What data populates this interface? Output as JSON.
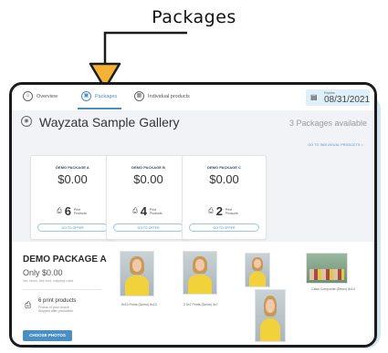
{
  "callout": {
    "label": "Packages"
  },
  "tabs": [
    {
      "label": "Overview",
      "icon": "home-icon"
    },
    {
      "label": "Packages",
      "icon": "gift-icon",
      "active": true
    },
    {
      "label": "Individual products",
      "icon": "photo-icon"
    }
  ],
  "expires": {
    "label": "Expires",
    "date": "08/31/2021"
  },
  "gallery": {
    "title": "Wayzata Sample Gallery",
    "package_count": "3 Packages available"
  },
  "link_individual": "GO TO INDIVIDUAL PRODUCTS >",
  "packages": [
    {
      "name": "DEMO PACKAGE A",
      "price": "$0.00",
      "count": "6",
      "count_label": "Print Products",
      "button": "GO TO OFFER"
    },
    {
      "name": "DEMO PACKAGE B",
      "price": "$0.00",
      "count": "4",
      "count_label": "Print Products",
      "button": "GO TO OFFER"
    },
    {
      "name": "DEMO PACKAGE C",
      "price": "$0.00",
      "count": "2",
      "count_label": "Print Products",
      "button": "GO TO OFFER"
    }
  ],
  "detail": {
    "name": "DEMO PACKAGE A",
    "price": "Only $0.00",
    "note": "Incl. taxes. See excl. shipping costs",
    "products_title": "6 print products",
    "products_line1": "Photos of your choice",
    "products_line2": "Shipped after production",
    "choose_button": "CHOOSE PHOTOS",
    "photos": [
      {
        "caption": "8x10 Prints (Demo) 8x10"
      },
      {
        "caption": "2 5x7 Prints (Demo) 5x7"
      },
      {
        "caption": ""
      },
      {
        "caption": "Class Composite (Demo) 8x10"
      }
    ]
  },
  "colors": {
    "accent": "#4a8fc4",
    "arrow": "#f5b335",
    "shadow": "#cfe6f0"
  }
}
